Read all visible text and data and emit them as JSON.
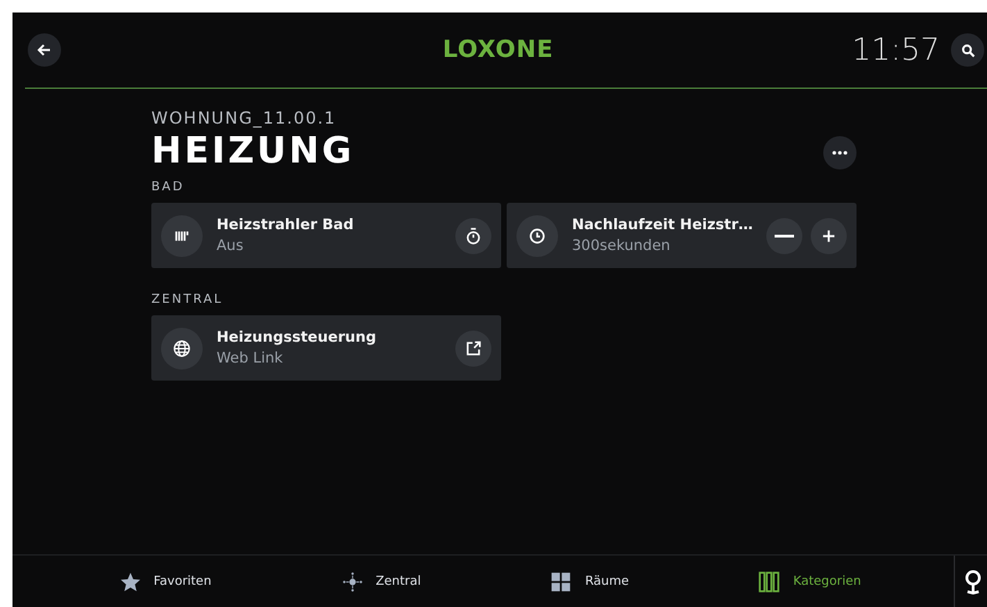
{
  "header": {
    "logo": "LOXONE",
    "time": "11:57"
  },
  "page": {
    "room": "WOHNUNG_11.00.1",
    "title": "HEIZUNG"
  },
  "sections": [
    {
      "label": "BAD",
      "cards": [
        {
          "kind": "switch",
          "title": "Heizstrahler Bad",
          "subtitle": "Aus"
        },
        {
          "kind": "stepper",
          "title": "Nachlaufzeit Heizstr…",
          "subtitle": "300sekunden"
        }
      ]
    },
    {
      "label": "ZENTRAL",
      "cards": [
        {
          "kind": "link",
          "title": "Heizungssteuerung",
          "subtitle": "Web Link"
        }
      ]
    }
  ],
  "tabs": [
    {
      "label": "Favoriten",
      "selected": false
    },
    {
      "label": "Zentral",
      "selected": false
    },
    {
      "label": "Räume",
      "selected": false
    },
    {
      "label": "Kategorien",
      "selected": true
    }
  ]
}
